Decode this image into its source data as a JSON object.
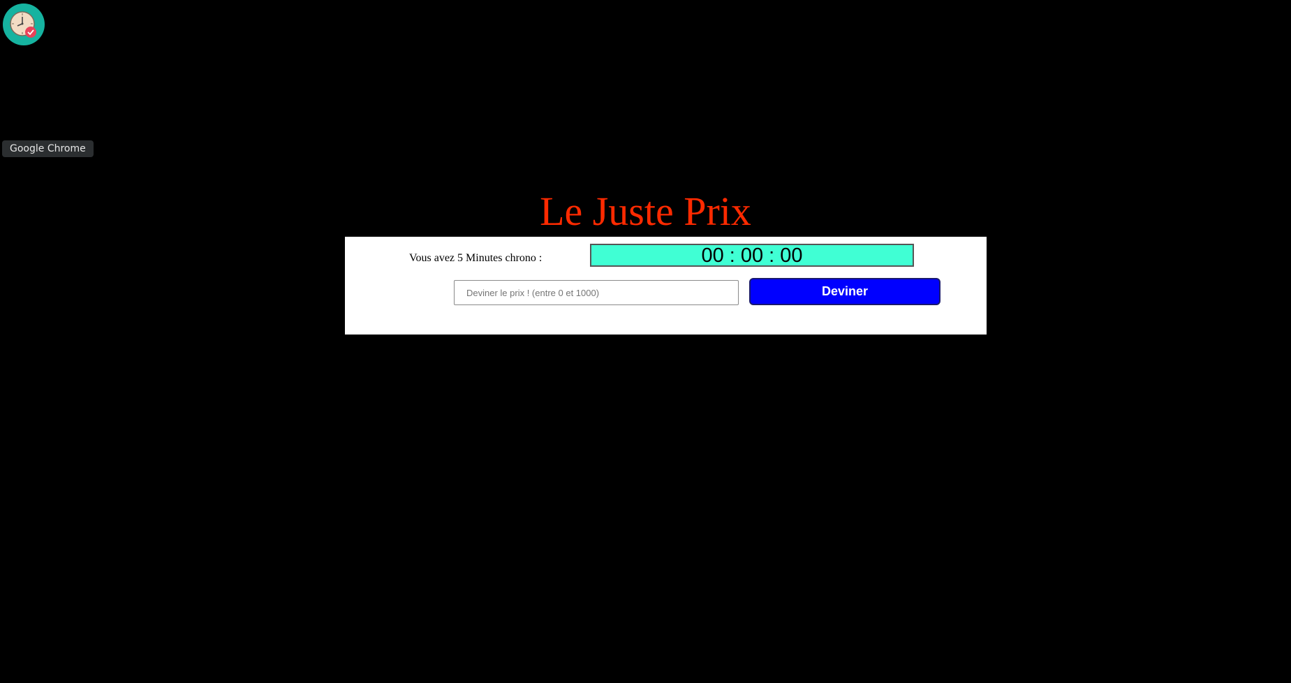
{
  "dock": {
    "app_icon": "clock-check-icon",
    "tooltip": "Google Chrome"
  },
  "game": {
    "title": "Le Juste Prix",
    "timer_label": "Vous avez 5 Minutes chrono :",
    "timer_value": "00 : 00 : 00",
    "input_placeholder": "Deviner le prix ! (entre 0 et 1000)",
    "input_value": "",
    "button_label": "Deviner"
  },
  "colors": {
    "background": "#000000",
    "title": "#ff2a00",
    "timer_background": "#40ffd4",
    "button_background": "#0000ff",
    "dock_icon_background": "#16b3a0"
  }
}
